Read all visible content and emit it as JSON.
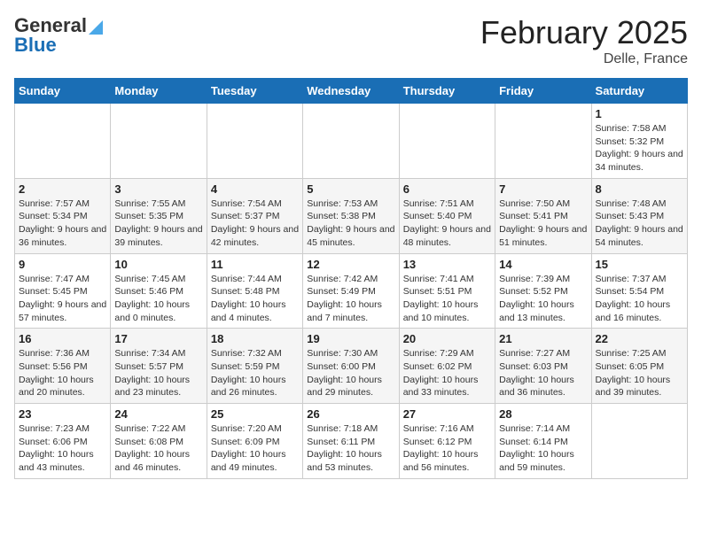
{
  "header": {
    "logo_text_general": "General",
    "logo_text_blue": "Blue",
    "calendar_title": "February 2025",
    "calendar_subtitle": "Delle, France"
  },
  "weekdays": [
    "Sunday",
    "Monday",
    "Tuesday",
    "Wednesday",
    "Thursday",
    "Friday",
    "Saturday"
  ],
  "weeks": [
    [
      {
        "day": "",
        "info": ""
      },
      {
        "day": "",
        "info": ""
      },
      {
        "day": "",
        "info": ""
      },
      {
        "day": "",
        "info": ""
      },
      {
        "day": "",
        "info": ""
      },
      {
        "day": "",
        "info": ""
      },
      {
        "day": "1",
        "info": "Sunrise: 7:58 AM\nSunset: 5:32 PM\nDaylight: 9 hours and 34 minutes."
      }
    ],
    [
      {
        "day": "2",
        "info": "Sunrise: 7:57 AM\nSunset: 5:34 PM\nDaylight: 9 hours and 36 minutes."
      },
      {
        "day": "3",
        "info": "Sunrise: 7:55 AM\nSunset: 5:35 PM\nDaylight: 9 hours and 39 minutes."
      },
      {
        "day": "4",
        "info": "Sunrise: 7:54 AM\nSunset: 5:37 PM\nDaylight: 9 hours and 42 minutes."
      },
      {
        "day": "5",
        "info": "Sunrise: 7:53 AM\nSunset: 5:38 PM\nDaylight: 9 hours and 45 minutes."
      },
      {
        "day": "6",
        "info": "Sunrise: 7:51 AM\nSunset: 5:40 PM\nDaylight: 9 hours and 48 minutes."
      },
      {
        "day": "7",
        "info": "Sunrise: 7:50 AM\nSunset: 5:41 PM\nDaylight: 9 hours and 51 minutes."
      },
      {
        "day": "8",
        "info": "Sunrise: 7:48 AM\nSunset: 5:43 PM\nDaylight: 9 hours and 54 minutes."
      }
    ],
    [
      {
        "day": "9",
        "info": "Sunrise: 7:47 AM\nSunset: 5:45 PM\nDaylight: 9 hours and 57 minutes."
      },
      {
        "day": "10",
        "info": "Sunrise: 7:45 AM\nSunset: 5:46 PM\nDaylight: 10 hours and 0 minutes."
      },
      {
        "day": "11",
        "info": "Sunrise: 7:44 AM\nSunset: 5:48 PM\nDaylight: 10 hours and 4 minutes."
      },
      {
        "day": "12",
        "info": "Sunrise: 7:42 AM\nSunset: 5:49 PM\nDaylight: 10 hours and 7 minutes."
      },
      {
        "day": "13",
        "info": "Sunrise: 7:41 AM\nSunset: 5:51 PM\nDaylight: 10 hours and 10 minutes."
      },
      {
        "day": "14",
        "info": "Sunrise: 7:39 AM\nSunset: 5:52 PM\nDaylight: 10 hours and 13 minutes."
      },
      {
        "day": "15",
        "info": "Sunrise: 7:37 AM\nSunset: 5:54 PM\nDaylight: 10 hours and 16 minutes."
      }
    ],
    [
      {
        "day": "16",
        "info": "Sunrise: 7:36 AM\nSunset: 5:56 PM\nDaylight: 10 hours and 20 minutes."
      },
      {
        "day": "17",
        "info": "Sunrise: 7:34 AM\nSunset: 5:57 PM\nDaylight: 10 hours and 23 minutes."
      },
      {
        "day": "18",
        "info": "Sunrise: 7:32 AM\nSunset: 5:59 PM\nDaylight: 10 hours and 26 minutes."
      },
      {
        "day": "19",
        "info": "Sunrise: 7:30 AM\nSunset: 6:00 PM\nDaylight: 10 hours and 29 minutes."
      },
      {
        "day": "20",
        "info": "Sunrise: 7:29 AM\nSunset: 6:02 PM\nDaylight: 10 hours and 33 minutes."
      },
      {
        "day": "21",
        "info": "Sunrise: 7:27 AM\nSunset: 6:03 PM\nDaylight: 10 hours and 36 minutes."
      },
      {
        "day": "22",
        "info": "Sunrise: 7:25 AM\nSunset: 6:05 PM\nDaylight: 10 hours and 39 minutes."
      }
    ],
    [
      {
        "day": "23",
        "info": "Sunrise: 7:23 AM\nSunset: 6:06 PM\nDaylight: 10 hours and 43 minutes."
      },
      {
        "day": "24",
        "info": "Sunrise: 7:22 AM\nSunset: 6:08 PM\nDaylight: 10 hours and 46 minutes."
      },
      {
        "day": "25",
        "info": "Sunrise: 7:20 AM\nSunset: 6:09 PM\nDaylight: 10 hours and 49 minutes."
      },
      {
        "day": "26",
        "info": "Sunrise: 7:18 AM\nSunset: 6:11 PM\nDaylight: 10 hours and 53 minutes."
      },
      {
        "day": "27",
        "info": "Sunrise: 7:16 AM\nSunset: 6:12 PM\nDaylight: 10 hours and 56 minutes."
      },
      {
        "day": "28",
        "info": "Sunrise: 7:14 AM\nSunset: 6:14 PM\nDaylight: 10 hours and 59 minutes."
      },
      {
        "day": "",
        "info": ""
      }
    ]
  ]
}
